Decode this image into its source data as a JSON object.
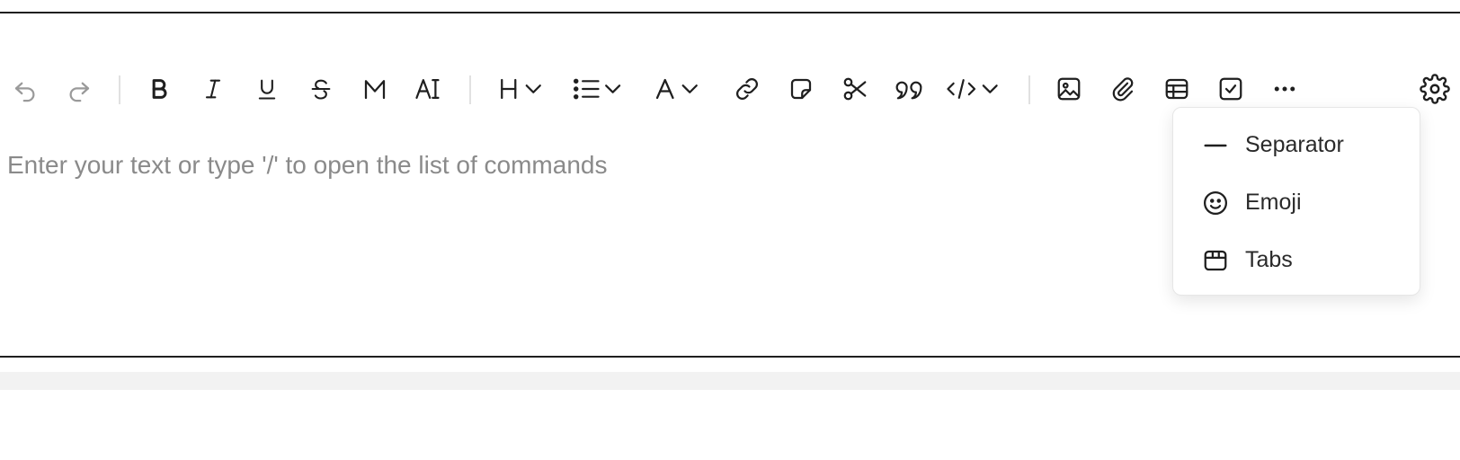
{
  "editor": {
    "placeholder": "Enter your text or type '/' to open the list of commands"
  },
  "toolbar": {
    "buttons": [
      {
        "icon": "undo-icon",
        "state": "disabled"
      },
      {
        "icon": "redo-icon",
        "state": "disabled"
      },
      {
        "icon": "bold-icon"
      },
      {
        "icon": "italic-icon"
      },
      {
        "icon": "underline-icon"
      },
      {
        "icon": "strikethrough-icon"
      },
      {
        "icon": "mark-icon"
      },
      {
        "icon": "text-size-icon"
      },
      {
        "icon": "heading-dropdown-icon"
      },
      {
        "icon": "list-dropdown-icon"
      },
      {
        "icon": "font-color-dropdown-icon"
      },
      {
        "icon": "link-icon"
      },
      {
        "icon": "note-icon"
      },
      {
        "icon": "scissors-icon"
      },
      {
        "icon": "quote-icon"
      },
      {
        "icon": "code-dropdown-icon"
      },
      {
        "icon": "image-icon"
      },
      {
        "icon": "attachment-icon"
      },
      {
        "icon": "table-icon"
      },
      {
        "icon": "checklist-icon"
      },
      {
        "icon": "more-icon"
      },
      {
        "icon": "settings-icon"
      }
    ]
  },
  "more_menu": {
    "items": [
      {
        "label": "Separator",
        "icon": "horizontal-rule-icon"
      },
      {
        "label": "Emoji",
        "icon": "emoji-icon"
      },
      {
        "label": "Tabs",
        "icon": "tabs-icon"
      }
    ]
  },
  "colors": {
    "icon": "#1f1f1f",
    "icon_disabled": "#9a9a9a",
    "placeholder": "#8a8a8a",
    "divider": "#e1e1e1"
  }
}
